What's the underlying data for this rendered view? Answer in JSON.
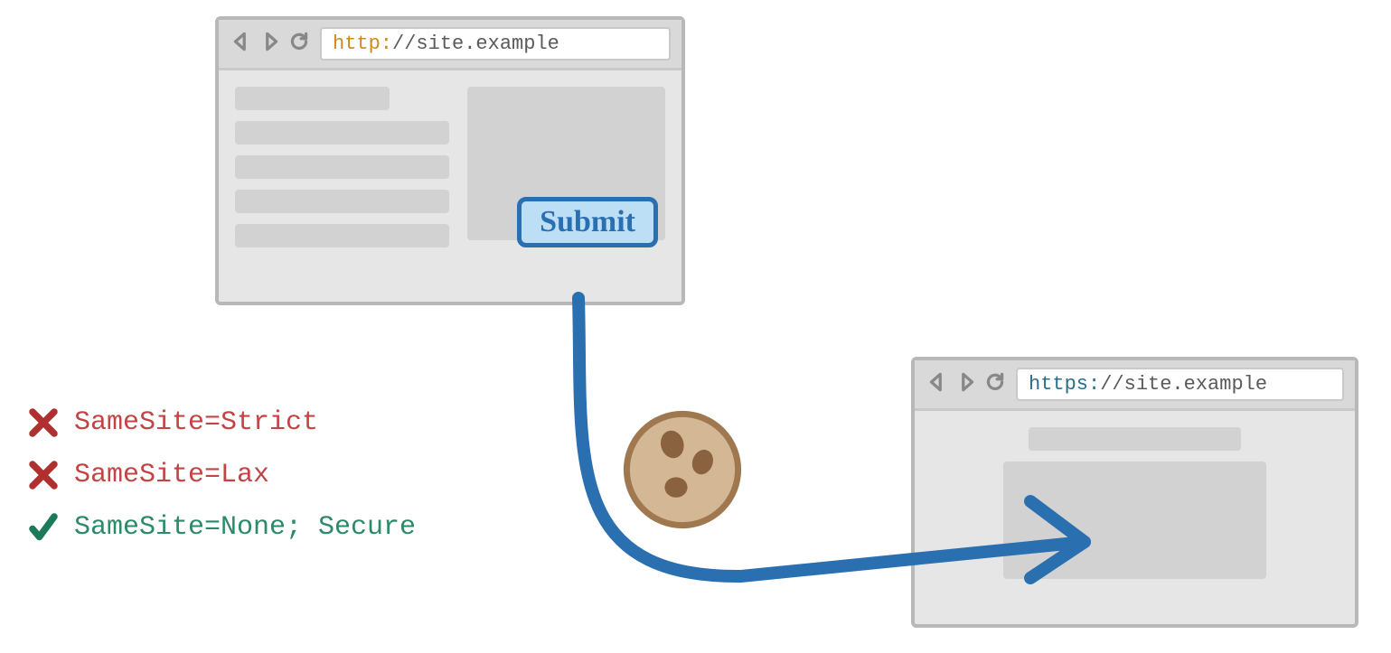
{
  "browser1": {
    "url_scheme": "http:",
    "url_path": "//site.example",
    "submit_label": "Submit"
  },
  "browser2": {
    "url_scheme": "https:",
    "url_path": "//site.example"
  },
  "rules": [
    {
      "label": "SameSite=Strict",
      "allowed": false
    },
    {
      "label": "SameSite=Lax",
      "allowed": false
    },
    {
      "label": "SameSite=None; Secure",
      "allowed": true
    }
  ],
  "icons": {
    "back": "back-icon",
    "forward": "forward-icon",
    "reload": "reload-icon",
    "cookie": "cookie-icon",
    "cross": "cross-icon",
    "check": "check-icon"
  }
}
